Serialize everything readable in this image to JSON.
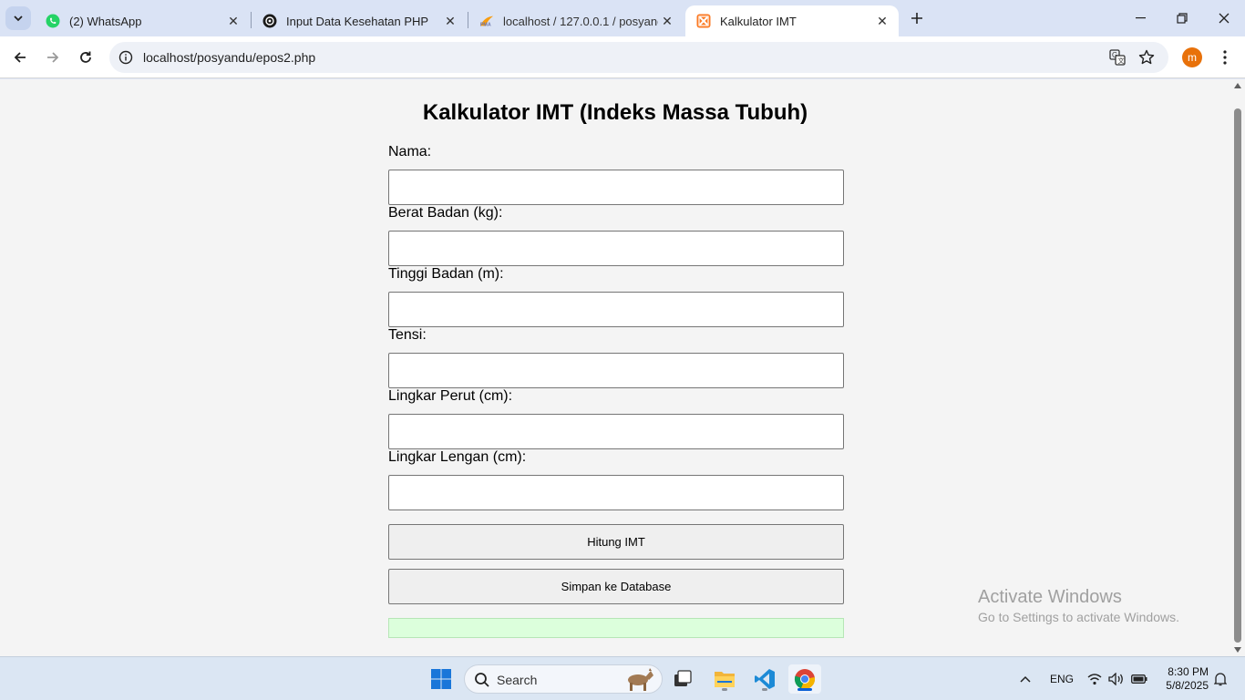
{
  "browser": {
    "tabs": [
      {
        "title": "(2) WhatsApp",
        "favicon": "whatsapp-icon"
      },
      {
        "title": "Input Data Kesehatan PHP",
        "favicon": "chatgpt-icon"
      },
      {
        "title": "localhost / 127.0.0.1 / posyandu",
        "favicon": "phpmyadmin-icon"
      },
      {
        "title": "Kalkulator IMT",
        "favicon": "xampp-icon",
        "active": true
      }
    ],
    "url": "localhost/posyandu/epos2.php",
    "profile_initial": "m"
  },
  "page": {
    "title": "Kalkulator IMT (Indeks Massa Tubuh)",
    "fields": [
      {
        "label": "Nama:",
        "value": ""
      },
      {
        "label": "Berat Badan (kg):",
        "value": ""
      },
      {
        "label": "Tinggi Badan (m):",
        "value": ""
      },
      {
        "label": "Tensi:",
        "value": ""
      },
      {
        "label": "Lingkar Perut (cm):",
        "value": ""
      },
      {
        "label": "Lingkar Lengan (cm):",
        "value": ""
      }
    ],
    "buttons": {
      "calculate": "Hitung IMT",
      "save": "Simpan ke Database"
    },
    "result": ""
  },
  "watermark": {
    "line1": "Activate Windows",
    "line2": "Go to Settings to activate Windows."
  },
  "taskbar": {
    "search_label": "Search",
    "language": "ENG",
    "time": "8:30 PM",
    "date": "5/8/2025"
  },
  "colors": {
    "accent": "#0a5fd6",
    "result_bg": "#dcffdc",
    "profile": "#e8710a"
  }
}
